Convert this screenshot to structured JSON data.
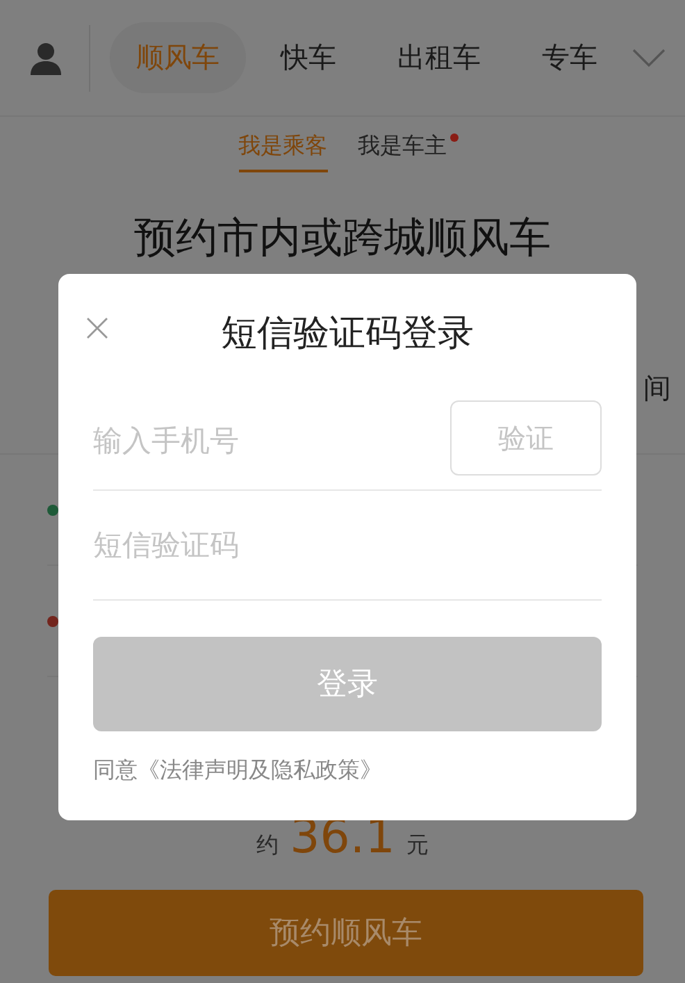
{
  "top_tabs": [
    {
      "label": "顺风车",
      "selected": true
    },
    {
      "label": "快车",
      "selected": false
    },
    {
      "label": "出租车",
      "selected": false
    },
    {
      "label": "专车",
      "selected": false
    }
  ],
  "role_tabs": [
    {
      "label": "我是乘客",
      "selected": true,
      "badge": false
    },
    {
      "label": "我是车主",
      "selected": false,
      "badge": true
    }
  ],
  "heading": "预约市内或跨城顺风车",
  "time_field": {
    "text": "间"
  },
  "route": [
    {
      "color": "#1e5a38"
    },
    {
      "color": "#73251d"
    }
  ],
  "price": {
    "prefix": "约",
    "amount": "36.1",
    "unit": "元"
  },
  "submit_button": "预约顺风车",
  "dialog": {
    "title": "短信验证码登录",
    "phone_placeholder": "输入手机号",
    "verify_button": {
      "label": "验证",
      "disabled": true
    },
    "code_placeholder": "短信验证码",
    "login_button": {
      "label": "登录",
      "disabled": true
    },
    "agreement": "同意《法律声明及隐私政策》"
  }
}
